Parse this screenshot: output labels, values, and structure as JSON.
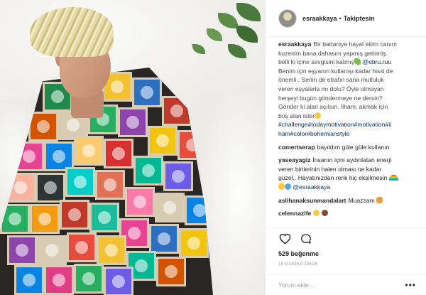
{
  "post": {
    "username": "esraakkaya",
    "follow_status": "Takiptesin",
    "photo_alt": "Woman with short bleached hair wrapped in a colorful granny-square crochet blanket"
  },
  "caption": {
    "username": "esraakkaya",
    "lines": [
      "Bir battaniye hayal ettim canım",
      "kuzenim bana dahasını yapmış getirmiş.",
      "belli ki içine sevgisini katmış",
      "Benim için eşyanın kullanışı kadar hissi de",
      "önemli.. Senin de etrafın sana mutluluk",
      "veren eşyalarla mı dolu? Öyle olmayan",
      "herşeyi bugün göndermeye ne dersin?",
      "Gönder ki alan açılsın. İlham; akmak için",
      "boş alan ister"
    ],
    "mention": "@ebru.ruu",
    "hashtags_line1": "#challenge#todaymotivation#motivation#il",
    "hashtags_line2": "ham#color#bohemianstyle"
  },
  "comments": [
    {
      "username": "comertserap",
      "lines": [
        "bayıldım güle güle kullanın"
      ]
    },
    {
      "username": "yaseayagiz",
      "lines": [
        "İnsanın içini aydınlatan enerji",
        "veren birilerinin halen olması ne kadar",
        "güzel.. Hayatınızdan renk hiç eksilmesin"
      ],
      "mention": "@esraakkaya"
    },
    {
      "username": "aslihanaksunmandalart",
      "lines": [
        "Muazzam"
      ]
    },
    {
      "username": "celennazife",
      "lines": [
        ""
      ]
    }
  ],
  "actions": {
    "like_icon": "heart-outline-icon",
    "comment_icon": "comment-bubble-icon"
  },
  "likes": "529 beğenme",
  "timestamp": "10 DAKİKA ÖNCE",
  "add_comment": {
    "placeholder": "Yorum ekle...",
    "more_label": "•••"
  },
  "colors": {
    "link": "#003569",
    "muted": "#999999",
    "text": "#262626",
    "divider": "#efefef"
  }
}
